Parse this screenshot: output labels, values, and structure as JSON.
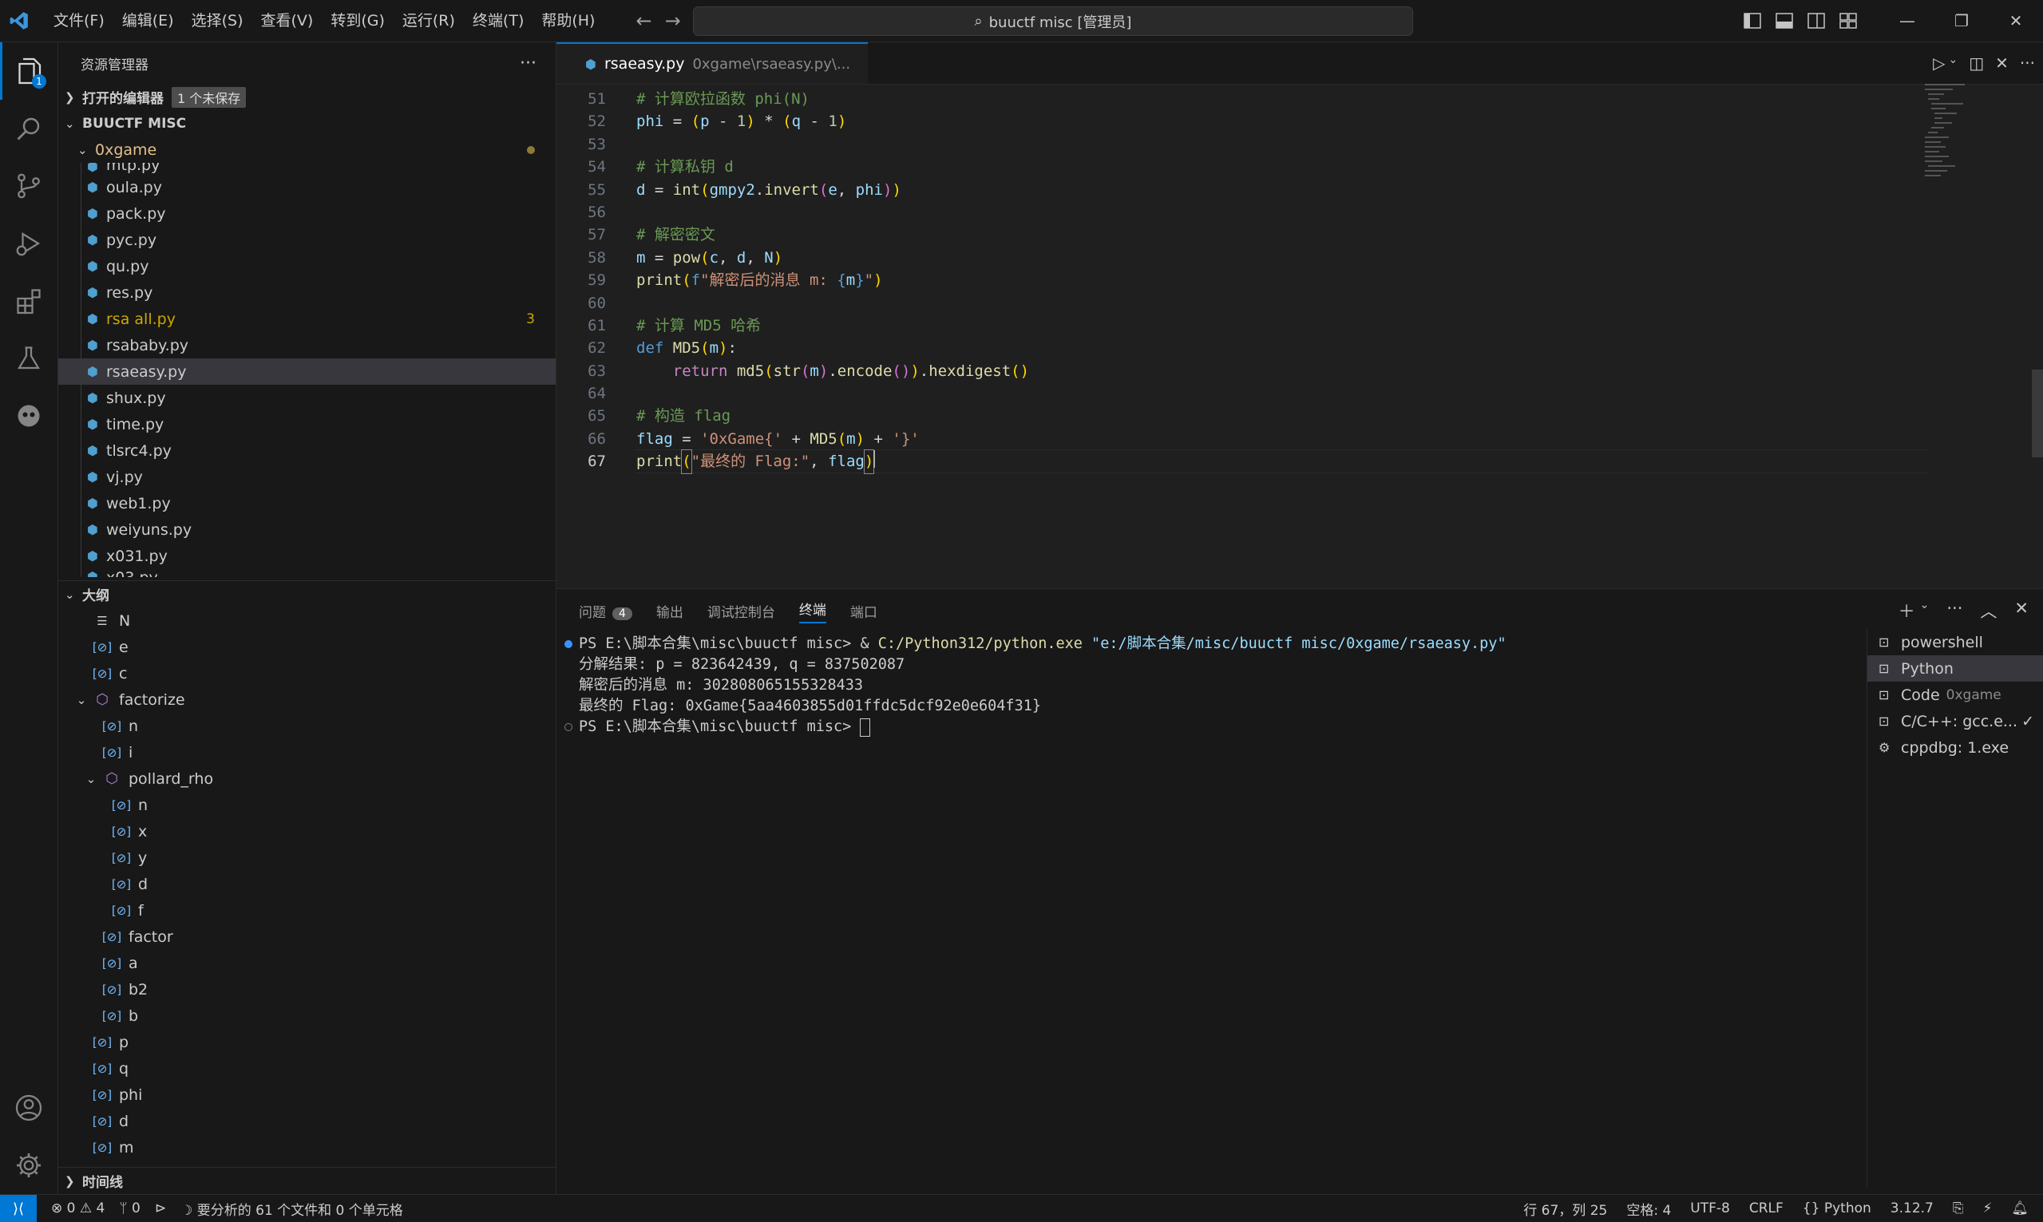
{
  "menu": [
    "文件(F)",
    "编辑(E)",
    "选择(S)",
    "查看(V)",
    "转到(G)",
    "运行(R)",
    "终端(T)",
    "帮助(H)"
  ],
  "search": {
    "text": "buuctf misc [管理员]"
  },
  "explorer": {
    "title": "资源管理器",
    "open_editors": "打开的编辑器",
    "unsaved": "1 个未保存",
    "workspace": "BUUCTF MISC",
    "folder": "0xgame",
    "partial_top": "mtp.py",
    "files": [
      "oula.py",
      "pack.py",
      "pyc.py",
      "qu.py",
      "res.py",
      "rsa all.py",
      "rsababy.py",
      "rsaeasy.py",
      "shux.py",
      "time.py",
      "tlsrc4.py",
      "vj.py",
      "web1.py",
      "weiyuns.py",
      "x031.py"
    ],
    "warn_count": "3",
    "partial_bottom": "x03.py"
  },
  "outline": {
    "title": "大纲",
    "items": [
      {
        "label": "N"
      },
      {
        "label": "e"
      },
      {
        "label": "c"
      },
      {
        "label": "factorize"
      },
      {
        "label": "n"
      },
      {
        "label": "i"
      },
      {
        "label": "pollard_rho"
      },
      {
        "label": "n"
      },
      {
        "label": "x"
      },
      {
        "label": "y"
      },
      {
        "label": "d"
      },
      {
        "label": "f"
      },
      {
        "label": "factor"
      },
      {
        "label": "a"
      },
      {
        "label": "b2"
      },
      {
        "label": "b"
      },
      {
        "label": "p"
      },
      {
        "label": "q"
      },
      {
        "label": "phi"
      },
      {
        "label": "d"
      },
      {
        "label": "m"
      }
    ]
  },
  "timeline": "时间线",
  "tab": {
    "name": "rsaeasy.py",
    "path": "0xgame\\rsaeasy.py\\..."
  },
  "code_lines": {
    "51": "# 计算欧拉函数 phi(N)",
    "52": "phi = (p - 1) * (q - 1)",
    "53": "",
    "54": "# 计算私钥 d",
    "55": "d = int(gmpy2.invert(e, phi))",
    "56": "",
    "57": "# 解密密文",
    "58": "m = pow(c, d, N)",
    "59": "print(f\"解密后的消息 m: {m}\")",
    "60": "",
    "61": "# 计算 MD5 哈希",
    "62": "def MD5(m):",
    "63": "    return md5(str(m).encode()).hexdigest()",
    "64": "",
    "65": "# 构造 flag",
    "66": "flag = '0xGame{' + MD5(m) + '}'",
    "67": "print(\"最终的 Flag:\", flag)"
  },
  "line_numbers": [
    "51",
    "52",
    "53",
    "54",
    "55",
    "56",
    "57",
    "58",
    "59",
    "60",
    "61",
    "62",
    "63",
    "64",
    "65",
    "66",
    "67"
  ],
  "panel": {
    "tabs": [
      "问题",
      "输出",
      "调试控制台",
      "终端",
      "端口"
    ],
    "problems_count": "4"
  },
  "terminal": {
    "prompt1": "PS E:\\脚本合集\\misc\\buuctf misc> & ",
    "exe": "C:/Python312/python.exe",
    "arg": " \"e:/脚本合集/misc/buuctf misc/0xgame/rsaeasy.py\"",
    "out1": "分解结果: p = 823642439, q = 837502087",
    "out2": "解密后的消息 m: 302808065155328433",
    "out3": "最终的 Flag: 0xGame{5aa4603855d01ffdc5dcf92e0e604f31}",
    "prompt2": "PS E:\\脚本合集\\misc\\buuctf misc> "
  },
  "terminals": [
    {
      "name": "powershell",
      "sub": ""
    },
    {
      "name": "Python",
      "sub": ""
    },
    {
      "name": "Code",
      "sub": "0xgame"
    },
    {
      "name": "C/C++: gcc.e...",
      "sub": ""
    },
    {
      "name": "cppdbg: 1.exe",
      "sub": ""
    }
  ],
  "status": {
    "errors": "0",
    "warnings": "4",
    "ports": "0",
    "analysis": "要分析的 61 个文件和 0 个单元格",
    "position": "行 67，列 25",
    "spaces": "空格: 4",
    "encoding": "UTF-8",
    "eol": "CRLF",
    "language": "Python",
    "version": "3.12.7"
  },
  "colors": {
    "accent": "#0078d4",
    "warn": "#cca700",
    "folder": "#e2c08d"
  }
}
